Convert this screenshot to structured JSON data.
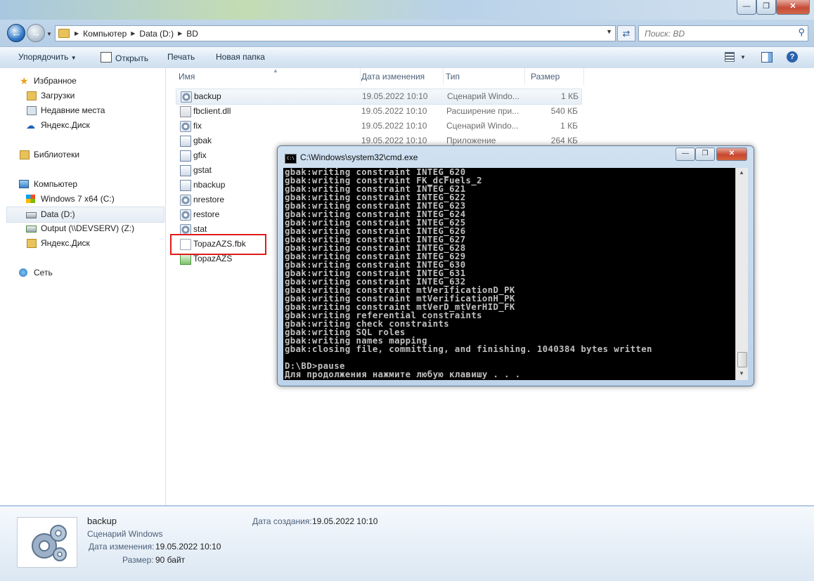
{
  "explorer": {
    "breadcrumb": [
      "Компьютер",
      "Data (D:)",
      "BD"
    ],
    "search_placeholder": "Поиск: BD",
    "commands": {
      "organize": "Упорядочить",
      "open": "Открыть",
      "print": "Печать",
      "new_folder": "Новая папка"
    },
    "nav": {
      "favorites": "Избранное",
      "downloads": "Загрузки",
      "recent": "Недавние места",
      "yadisk_fav": "Яндекс.Диск",
      "libraries": "Библиотеки",
      "computer": "Компьютер",
      "drive_c": "Windows 7 x64 (C:)",
      "drive_d": "Data (D:)",
      "drive_z": "Output (\\\\DEVSERV) (Z:)",
      "yadisk": "Яндекс.Диск",
      "network": "Сеть"
    },
    "columns": {
      "name": "Имя",
      "date": "Дата изменения",
      "type": "Тип",
      "size": "Размер"
    },
    "files": [
      {
        "name": "backup",
        "date": "19.05.2022 10:10",
        "type": "Сценарий Windo...",
        "size": "1 КБ",
        "icon": "script-gear-icon"
      },
      {
        "name": "fbclient.dll",
        "date": "19.05.2022 10:10",
        "type": "Расширение при...",
        "size": "540 КБ",
        "icon": "dll-icon"
      },
      {
        "name": "fix",
        "date": "19.05.2022 10:10",
        "type": "Сценарий Windo...",
        "size": "1 КБ",
        "icon": "script-gear-icon"
      },
      {
        "name": "gbak",
        "date": "19.05.2022 10:10",
        "type": "Приложение",
        "size": "264 КБ",
        "icon": "application-icon"
      },
      {
        "name": "gfix",
        "date": "",
        "type": "",
        "size": "",
        "icon": "application-icon"
      },
      {
        "name": "gstat",
        "date": "",
        "type": "",
        "size": "",
        "icon": "application-icon"
      },
      {
        "name": "nbackup",
        "date": "",
        "type": "",
        "size": "",
        "icon": "application-icon"
      },
      {
        "name": "nrestore",
        "date": "",
        "type": "",
        "size": "",
        "icon": "script-gear-icon"
      },
      {
        "name": "restore",
        "date": "",
        "type": "",
        "size": "",
        "icon": "script-gear-icon"
      },
      {
        "name": "stat",
        "date": "",
        "type": "",
        "size": "",
        "icon": "script-gear-icon"
      },
      {
        "name": "TopazAZS.fbk",
        "date": "",
        "type": "",
        "size": "",
        "icon": "blank-file-icon"
      },
      {
        "name": "TopazAZS",
        "date": "",
        "type": "",
        "size": "",
        "icon": "shortcut-icon"
      }
    ],
    "details": {
      "name": "backup",
      "type": "Сценарий Windows",
      "modified_label": "Дата изменения:",
      "modified_value": "19.05.2022 10:10",
      "size_label": "Размер:",
      "size_value": "90 байт",
      "created_label": "Дата создания:",
      "created_value": "19.05.2022 10:10"
    }
  },
  "cmd": {
    "title": "C:\\Windows\\system32\\cmd.exe",
    "lines": [
      "gbak:writing constraint INTEG_620",
      "gbak:writing constraint FK_dcFuels_2",
      "gbak:writing constraint INTEG_621",
      "gbak:writing constraint INTEG_622",
      "gbak:writing constraint INTEG_623",
      "gbak:writing constraint INTEG_624",
      "gbak:writing constraint INTEG_625",
      "gbak:writing constraint INTEG_626",
      "gbak:writing constraint INTEG_627",
      "gbak:writing constraint INTEG_628",
      "gbak:writing constraint INTEG_629",
      "gbak:writing constraint INTEG_630",
      "gbak:writing constraint INTEG_631",
      "gbak:writing constraint INTEG_632",
      "gbak:writing constraint mtVerificationD_PK",
      "gbak:writing constraint mtVerificationH_PK",
      "gbak:writing constraint mtVerD_mtVerHID_FK",
      "gbak:writing referential constraints",
      "gbak:writing check constraints",
      "gbak:writing SQL roles",
      "gbak:writing names mapping",
      "gbak:closing file, committing, and finishing. 1040384 bytes written",
      "",
      "D:\\BD>pause",
      "Для продолжения нажмите любую клавишу . . ."
    ]
  },
  "colors": {
    "highlight_box": "#e01b1b",
    "console_bg": "#000000",
    "console_fg": "#c0c0c0"
  }
}
